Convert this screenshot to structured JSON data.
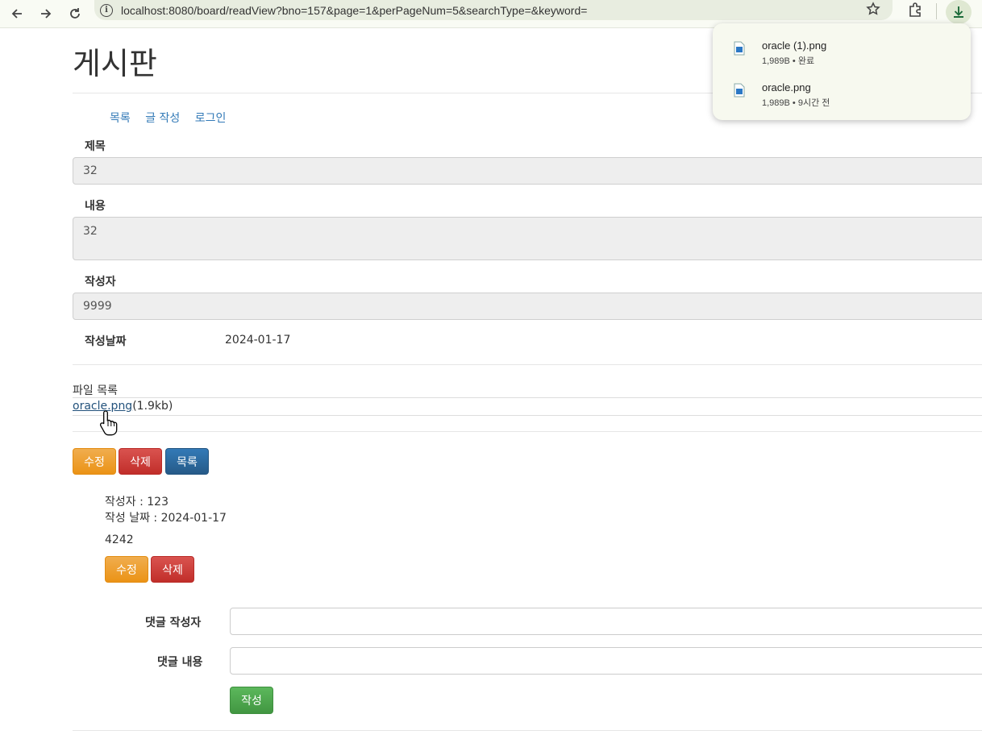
{
  "browser": {
    "url": "localhost:8080/board/readView?bno=157&page=1&perPageNum=5&searchType=&keyword=",
    "icons": [
      "back-icon",
      "forward-icon",
      "reload-icon",
      "info-icon",
      "star-icon",
      "extensions-icon",
      "download-icon"
    ]
  },
  "downloads": [
    {
      "name": "oracle (1).png",
      "meta": "1,989B • 완료"
    },
    {
      "name": "oracle.png",
      "meta": "1,989B • 9시간 전"
    }
  ],
  "page": {
    "title": "게시판",
    "nav": {
      "list": "목록",
      "write": "글 작성",
      "login": "로그인"
    }
  },
  "post": {
    "title_label": "제목",
    "title_value": "32",
    "content_label": "내용",
    "content_value": "32",
    "writer_label": "작성자",
    "writer_value": "9999",
    "date_label": "작성날짜",
    "date_value": "2024-01-17"
  },
  "files": {
    "label": "파일 목록",
    "items": [
      {
        "name": "oracle.png",
        "size": "(1.9kb)"
      }
    ]
  },
  "actions": {
    "edit": "수정",
    "delete": "삭제",
    "list": "목록"
  },
  "reply": {
    "writer": "작성자 : 123",
    "date": "작성 날짜 : 2024-01-17",
    "content": "4242",
    "edit": "수정",
    "delete": "삭제"
  },
  "reply_form": {
    "writer_label": "댓글 작성자",
    "content_label": "댓글 내용",
    "writer_value": "",
    "content_value": "",
    "submit": "작성"
  },
  "colors": {
    "warning": "#f0ad4e",
    "danger": "#d9534f",
    "primary": "#337ab7",
    "success": "#5cb85c",
    "link": "#337ab7"
  }
}
